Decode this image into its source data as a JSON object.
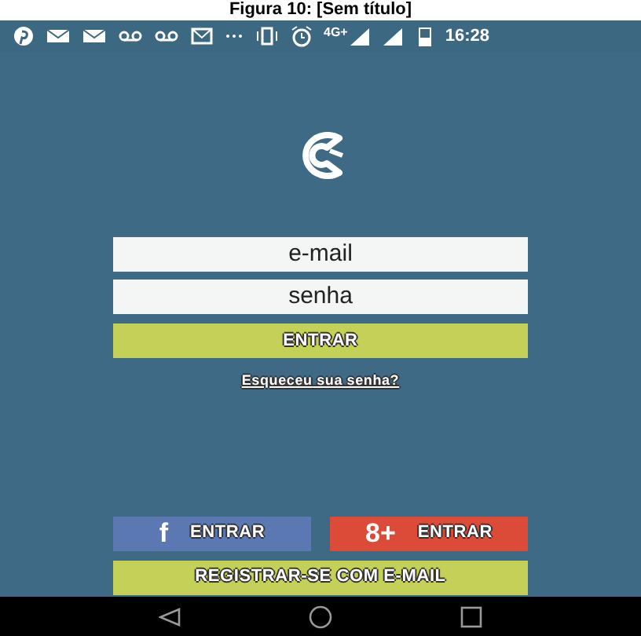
{
  "caption": "Figura 10: [Sem título]",
  "status_bar": {
    "network": "4G+",
    "time": "16:28"
  },
  "login": {
    "email": {
      "placeholder": "e-mail"
    },
    "password": {
      "placeholder": "senha"
    },
    "submit": "ENTRAR",
    "forgot_link": "Esqueceu sua senha?"
  },
  "social": [
    {
      "kind": "facebook",
      "icon": "f",
      "label": "ENTRAR"
    },
    {
      "kind": "google",
      "icon": "8+",
      "label": "ENTRAR"
    }
  ],
  "register": "REGISTRAR-SE COM E-MAIL"
}
